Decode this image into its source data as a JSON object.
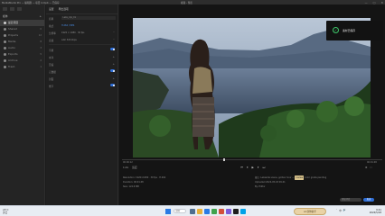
{
  "window": {
    "app_title": "MediaStudio Pro — 编辑器 — 项目 4.mp4 — 已保存",
    "doc_title": "视频 - 预览",
    "controls": [
      "—",
      "□",
      "✕"
    ]
  },
  "leftnav": {
    "header": "媒体",
    "header_action": "+",
    "items": [
      {
        "label": "最近项目",
        "count": "",
        "active": true
      },
      {
        "label": "Shared",
        "count": "0",
        "active": false
      },
      {
        "label": "Projects",
        "count": "12",
        "active": false
      },
      {
        "label": "Media",
        "count": "8",
        "active": false
      },
      {
        "label": "Audio",
        "count": "3",
        "active": false
      },
      {
        "label": "Exports",
        "count": "5",
        "active": false
      },
      {
        "label": "Archive",
        "count": "2",
        "active": false
      },
      {
        "label": "Trash",
        "count": "1",
        "active": false
      }
    ]
  },
  "settings": {
    "tabs": [
      "设置",
      "导出选项"
    ],
    "rows": [
      {
        "label": "名称",
        "value": "Lake_clip_01"
      },
      {
        "label": "格式",
        "value": "H.264 / MP4"
      },
      {
        "label": "分辨率",
        "value": "1920 × 1080 · 30 fps"
      },
      {
        "label": "音频",
        "value": "AAC 320 kbps"
      }
    ],
    "toggles": [
      {
        "label": "字幕",
        "state": "on"
      },
      {
        "label": "水印",
        "state": "off"
      },
      {
        "label": "压缩",
        "state": "off"
      },
      {
        "label": "元数据",
        "state": "on"
      },
      {
        "label": "封面",
        "state": "off"
      },
      {
        "label": "章节",
        "state": "on"
      }
    ]
  },
  "toast": {
    "message": "素材已保存"
  },
  "player": {
    "time_current": "00:00:12",
    "time_total": "00:01:48",
    "speed": "1.0x",
    "zoom": "适应",
    "controls": [
      "⏮",
      "⏴",
      "▶",
      "⏵",
      "⏭"
    ],
    "right_tools": [
      "⚙",
      "⛶"
    ],
    "progress": 0.39
  },
  "info": {
    "left_line1": "Resolution: 1920×1080 · 30 fps · H.264",
    "left_line2": "Duration: 00:01:48",
    "left_line3": "Size: 124.6 MB",
    "right_line1": "备注: Lakeside scene, golden hour —",
    "right_tag": "review",
    "right_line1b": "color grade pending",
    "right_line2": "Uploaded 2024-05-18 09:41",
    "right_line3": "By: Editor",
    "comment_placeholder": "添加评论",
    "comment_button": "发送"
  },
  "taskbar": {
    "weather": "23°C",
    "weather_desc": "多云",
    "search": "搜索",
    "badge": "AI 创作助手",
    "time": "9:41",
    "date": "2024/5/18",
    "tray": [
      "ˆ",
      "中",
      "🔊"
    ]
  }
}
